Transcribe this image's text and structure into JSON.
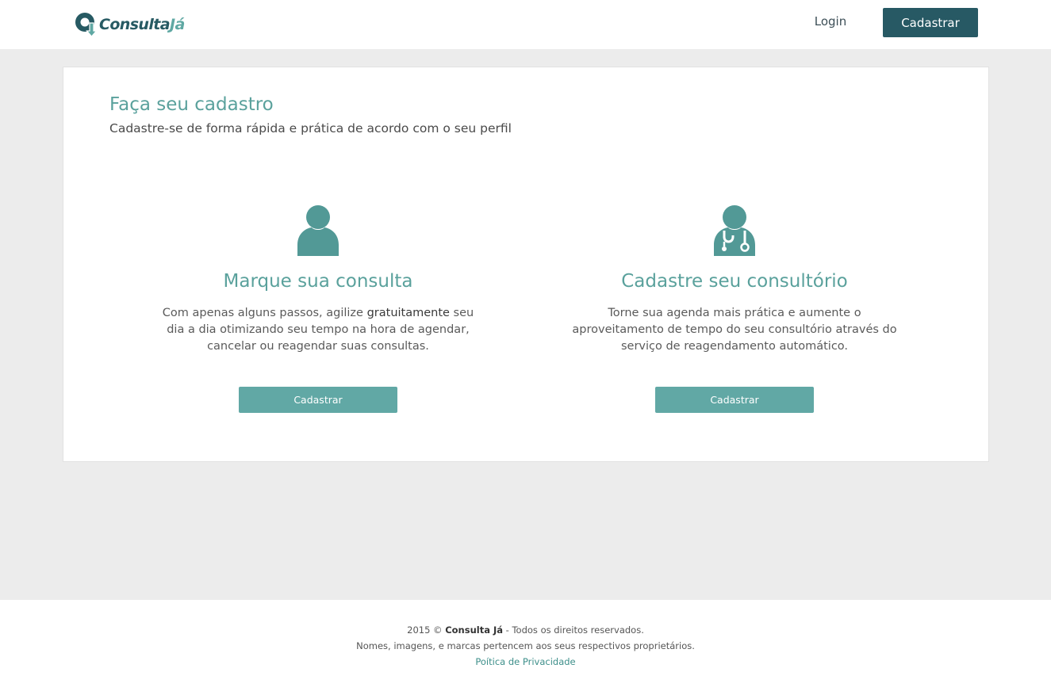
{
  "header": {
    "logo_text_main": "Consulta",
    "logo_text_accent": "Já",
    "login_label": "Login",
    "signup_label": "Cadastrar"
  },
  "main": {
    "title": "Faça seu cadastro",
    "subtitle": "Cadastre-se de forma rápida e prática de acordo com o seu perfil",
    "options": [
      {
        "icon": "user-icon",
        "title": "Marque sua consulta",
        "text_before": "Com apenas alguns passos, agilize ",
        "text_strong": "gratuitamente",
        "text_after": " seu dia a dia otimizando seu tempo na hora de agendar, cancelar ou reagendar suas consultas.",
        "button_label": "Cadastrar"
      },
      {
        "icon": "doctor-icon",
        "title": "Cadastre seu consultório",
        "text": "Torne sua agenda mais prática e aumente o aproveitamento de tempo do seu consultório através do serviço de reagendamento automático.",
        "button_label": "Cadastrar"
      }
    ]
  },
  "footer": {
    "year_copy": "2015 © ",
    "brand": "Consulta Já",
    "rights": " - Todos os direitos reservados.",
    "line2": "Nomes, imagens, e marcas pertencem aos seus respectivos proprietários.",
    "policy_label": "Poítica de Privacidade"
  },
  "colors": {
    "primary_dark": "#275964",
    "accent_teal": "#5aa19c",
    "button_teal": "#61a8a5",
    "page_background": "#ececec"
  }
}
